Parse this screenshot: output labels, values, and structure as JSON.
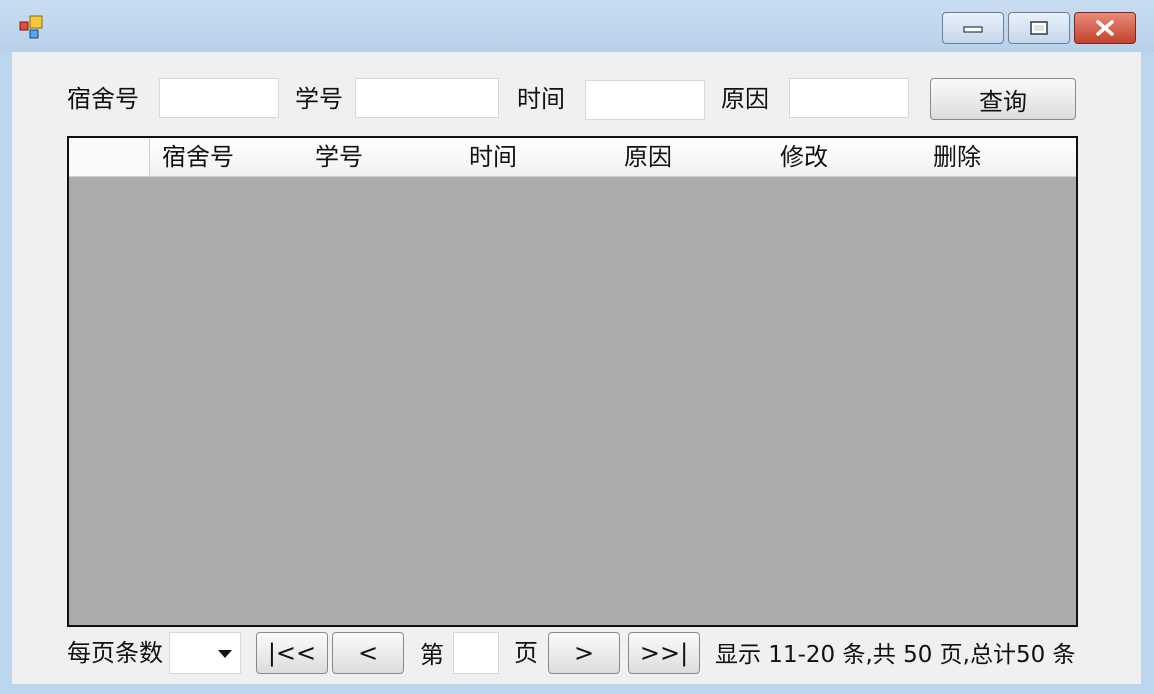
{
  "window": {
    "buttons": {
      "minimize": "minimize-icon",
      "maximize": "maximize-icon",
      "close": "close-icon"
    }
  },
  "search": {
    "dorm_label": "宿舍号",
    "student_label": "学号",
    "time_label": "时间",
    "reason_label": "原因",
    "dorm_value": "",
    "student_value": "",
    "time_value": "",
    "reason_value": "",
    "query_button": "查询"
  },
  "grid": {
    "columns": [
      "宿舍号",
      "学号",
      "时间",
      "原因",
      "修改",
      "删除"
    ],
    "rows": []
  },
  "pager": {
    "per_page_label": "每页条数",
    "per_page_value": "",
    "first_button": "|<<",
    "prev_button": "<",
    "page_prefix": "第",
    "page_value": "",
    "page_suffix": "页",
    "next_button": ">",
    "last_button": ">>|",
    "status_text": "显示 11-20 条,共 50 页,总计50 条"
  },
  "colors": {
    "grid_background": "#ababab",
    "client_background": "#f0f0f0",
    "title_bar": "#c9ddf1",
    "close_button": "#c2432c"
  }
}
